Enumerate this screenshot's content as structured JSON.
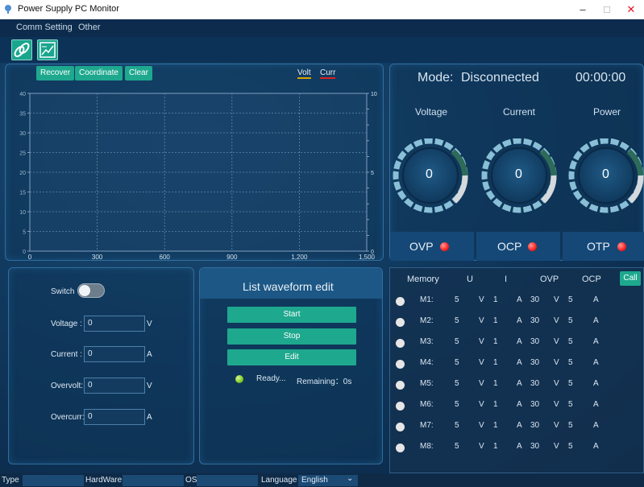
{
  "window": {
    "title": "Power Supply PC Monitor",
    "minimize": "–",
    "maximize": "□",
    "close": "✕"
  },
  "menu": [
    "Comm Setting",
    "Other"
  ],
  "toolbar": {
    "buttons": [
      "link-icon",
      "chart-icon"
    ]
  },
  "chart_panel": {
    "buttons": [
      "Recover",
      "Coordinate",
      "Clear"
    ],
    "legend": [
      "Volt",
      "Curr"
    ],
    "legend_colors": [
      "#d9a400",
      "#e02020"
    ]
  },
  "chart_data": {
    "type": "line",
    "x_ticks": [
      "0",
      "300",
      "600",
      "900",
      "1,200",
      "1,500"
    ],
    "y_left_ticks": [
      "0",
      "5",
      "10",
      "15",
      "20",
      "25",
      "30",
      "35",
      "40"
    ],
    "y_right_ticks": [
      "0",
      "5",
      "10"
    ],
    "xlim": [
      0,
      1500
    ],
    "ylim_left": [
      0,
      40
    ],
    "ylim_right": [
      0,
      10
    ],
    "grid": true,
    "series": []
  },
  "status": {
    "mode_label": "Mode:",
    "mode_value": "Disconnected",
    "time": "00:00:00",
    "meters": [
      {
        "label": "Voltage",
        "value": "0"
      },
      {
        "label": "Current",
        "value": "0"
      },
      {
        "label": "Power",
        "value": "0"
      }
    ],
    "protections": [
      "OVP",
      "OCP",
      "OTP"
    ]
  },
  "settings": {
    "switch_label": "Switch",
    "fields": [
      {
        "label": "Voltage :",
        "value": "0",
        "unit": "V"
      },
      {
        "label": "Current :",
        "value": "0",
        "unit": "A"
      },
      {
        "label": "Overvolt:",
        "value": "0",
        "unit": "V"
      },
      {
        "label": "Overcurr:",
        "value": "0",
        "unit": "A"
      }
    ]
  },
  "list_waveform": {
    "title": "List waveform edit",
    "buttons": [
      "Start",
      "Stop",
      "Edit"
    ],
    "status": "Ready...",
    "remaining": "Remaining：0s"
  },
  "memory": {
    "headers": [
      "Memory",
      "U",
      "I",
      "OVP",
      "OCP"
    ],
    "call_label": "Call",
    "rows": [
      {
        "name": "M1:",
        "u": "5",
        "uu": "V",
        "i": "1",
        "iu": "A",
        "ovp": "30",
        "ovpu": "V",
        "ocp": "5",
        "ocpu": "A"
      },
      {
        "name": "M2:",
        "u": "5",
        "uu": "V",
        "i": "1",
        "iu": "A",
        "ovp": "30",
        "ovpu": "V",
        "ocp": "5",
        "ocpu": "A"
      },
      {
        "name": "M3:",
        "u": "5",
        "uu": "V",
        "i": "1",
        "iu": "A",
        "ovp": "30",
        "ovpu": "V",
        "ocp": "5",
        "ocpu": "A"
      },
      {
        "name": "M4:",
        "u": "5",
        "uu": "V",
        "i": "1",
        "iu": "A",
        "ovp": "30",
        "ovpu": "V",
        "ocp": "5",
        "ocpu": "A"
      },
      {
        "name": "M5:",
        "u": "5",
        "uu": "V",
        "i": "1",
        "iu": "A",
        "ovp": "30",
        "ovpu": "V",
        "ocp": "5",
        "ocpu": "A"
      },
      {
        "name": "M6:",
        "u": "5",
        "uu": "V",
        "i": "1",
        "iu": "A",
        "ovp": "30",
        "ovpu": "V",
        "ocp": "5",
        "ocpu": "A"
      },
      {
        "name": "M7:",
        "u": "5",
        "uu": "V",
        "i": "1",
        "iu": "A",
        "ovp": "30",
        "ovpu": "V",
        "ocp": "5",
        "ocpu": "A"
      },
      {
        "name": "M8:",
        "u": "5",
        "uu": "V",
        "i": "1",
        "iu": "A",
        "ovp": "30",
        "ovpu": "V",
        "ocp": "5",
        "ocpu": "A"
      }
    ]
  },
  "statusbar": {
    "type_label": "Type",
    "hardware_label": "HardWare",
    "os_label": "OS",
    "language_label": "Language",
    "language_value": "English",
    "dropdown_arrow": "⌄"
  }
}
